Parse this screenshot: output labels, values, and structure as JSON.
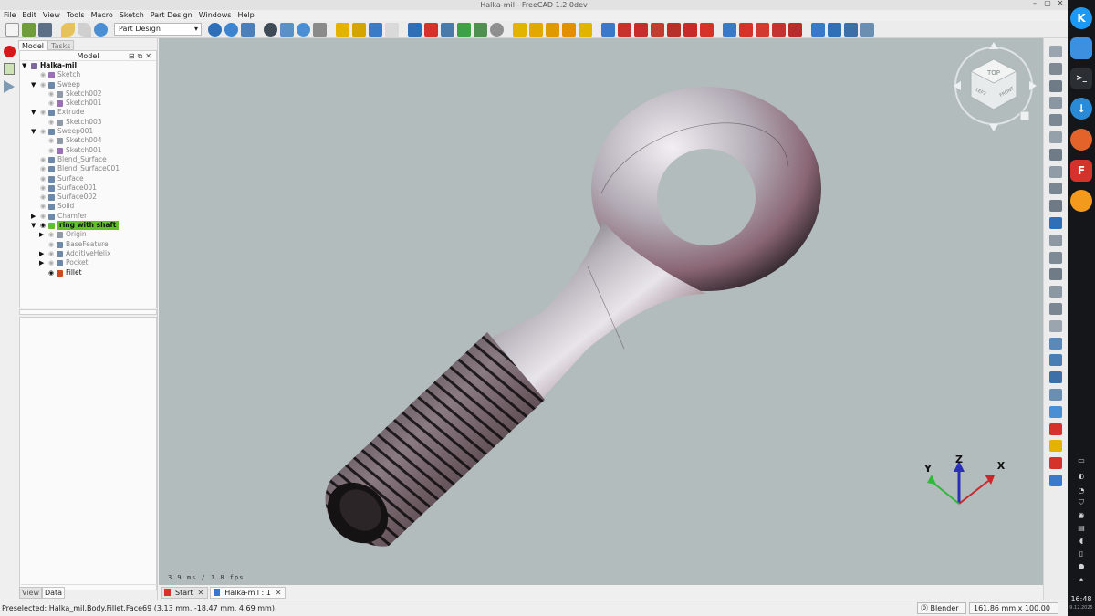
{
  "window": {
    "title": "Halka-mil - FreeCAD 1.2.0dev"
  },
  "menu": [
    "File",
    "Edit",
    "View",
    "Tools",
    "Macro",
    "Sketch",
    "Part Design",
    "Windows",
    "Help"
  ],
  "workbench_selector": {
    "value": "Part Design"
  },
  "combo_view": {
    "tabs": [
      "Model",
      "Tasks"
    ],
    "tree_header": "Model",
    "tree": [
      {
        "label": "Halka-mil",
        "level": 0,
        "arrow": "▼",
        "icon": "document-icon",
        "color": "#7f6aa0"
      },
      {
        "label": "Sketch",
        "level": 1,
        "arrow": "",
        "icon": "sketch-icon",
        "color": "#9b6fb5"
      },
      {
        "label": "Sweep",
        "level": 1,
        "arrow": "▼",
        "icon": "sweep-icon",
        "color": "#6d88a8"
      },
      {
        "label": "Sketch002",
        "level": 2,
        "arrow": "",
        "icon": "sketch-icon",
        "color": "#8f9aa6"
      },
      {
        "label": "Sketch001",
        "level": 2,
        "arrow": "",
        "icon": "sketch-icon",
        "color": "#9b6fb5"
      },
      {
        "label": "Extrude",
        "level": 1,
        "arrow": "▼",
        "icon": "extrude-icon",
        "color": "#6d88a8"
      },
      {
        "label": "Sketch003",
        "level": 2,
        "arrow": "",
        "icon": "sketch-icon",
        "color": "#8f9aa6"
      },
      {
        "label": "Sweep001",
        "level": 1,
        "arrow": "▼",
        "icon": "sweep-icon",
        "color": "#6d88a8"
      },
      {
        "label": "Sketch004",
        "level": 2,
        "arrow": "",
        "icon": "sketch-icon",
        "color": "#8f9aa6"
      },
      {
        "label": "Sketch001",
        "level": 2,
        "arrow": "",
        "icon": "sketch-icon",
        "color": "#9b6fb5"
      },
      {
        "label": "Blend_Surface",
        "level": 1,
        "arrow": "",
        "icon": "surface-icon",
        "color": "#6d88a8"
      },
      {
        "label": "Blend_Surface001",
        "level": 1,
        "arrow": "",
        "icon": "surface-icon",
        "color": "#6d88a8"
      },
      {
        "label": "Surface",
        "level": 1,
        "arrow": "",
        "icon": "surface-icon",
        "color": "#6d88a8"
      },
      {
        "label": "Surface001",
        "level": 1,
        "arrow": "",
        "icon": "surface-icon",
        "color": "#6d88a8"
      },
      {
        "label": "Surface002",
        "level": 1,
        "arrow": "",
        "icon": "surface-icon",
        "color": "#6d88a8"
      },
      {
        "label": "Solid",
        "level": 1,
        "arrow": "",
        "icon": "solid-icon",
        "color": "#6d88a8"
      },
      {
        "label": "Chamfer",
        "level": 1,
        "arrow": "▶",
        "icon": "chamfer-icon",
        "color": "#6d88a8"
      },
      {
        "label": "ring with shaft",
        "level": 1,
        "arrow": "▼",
        "icon": "body-icon",
        "color": "#5fc02c",
        "selected": true
      },
      {
        "label": "Origin",
        "level": 2,
        "arrow": "▶",
        "icon": "origin-icon",
        "color": "#8f9aa6"
      },
      {
        "label": "BaseFeature",
        "level": 2,
        "arrow": "",
        "icon": "base-feature-icon",
        "color": "#6d88a8"
      },
      {
        "label": "AdditiveHelix",
        "level": 2,
        "arrow": "▶",
        "icon": "helix-icon",
        "color": "#6d88a8"
      },
      {
        "label": "Pocket",
        "level": 2,
        "arrow": "▶",
        "icon": "pocket-icon",
        "color": "#6d88a8"
      },
      {
        "label": "Fillet",
        "level": 2,
        "arrow": "",
        "icon": "fillet-icon",
        "color": "#d14a1f",
        "active": true
      }
    ],
    "bottom_tabs": [
      "View",
      "Data"
    ]
  },
  "viewport": {
    "fps_text": "3.9 ms / 1.8 fps",
    "navcube": {
      "top": "TOP",
      "left": "LEFT",
      "front": "FRONT"
    },
    "axes": {
      "x": "X",
      "y": "Y",
      "z": "Z"
    }
  },
  "doc_tabs": [
    {
      "label": "Start",
      "active": false
    },
    {
      "label": "Halka-mil : 1",
      "active": true
    }
  ],
  "status": {
    "message": "Preselected: Halka_mil.Body.Fillet.Face69 (3.13 mm, -18.47 mm, 4.69 mm)",
    "nav_style": "Blender",
    "units": "161,86 mm x 100,00 mm"
  },
  "dock": {
    "time": "16:48",
    "date": "9.12.2025"
  },
  "colors": {
    "selection": "#5fc02c",
    "viewport_bg": "#b3bcbc",
    "toolbar_blue": "#2f6fb8",
    "toolbar_yellow": "#e2b400",
    "toolbar_red": "#d6322c"
  }
}
